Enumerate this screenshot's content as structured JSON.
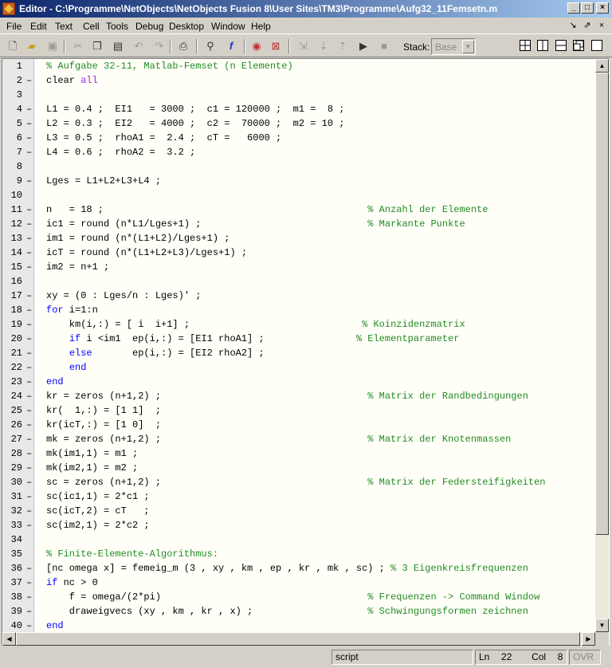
{
  "window": {
    "title": "Editor - C:\\Programme\\NetObjects\\NetObjects Fusion 8\\User Sites\\TM3\\Programme\\Aufg32_11Femsetn.m",
    "minimize": "_",
    "maximize": "□",
    "close": "×"
  },
  "menu": [
    "File",
    "Edit",
    "Text",
    "Cell",
    "Tools",
    "Debug",
    "Desktop",
    "Window",
    "Help"
  ],
  "mdi": {
    "undock": "↘",
    "restore": "⇗",
    "close": "×"
  },
  "toolbar": {
    "stack_label": "Stack:",
    "stack_value": "Base"
  },
  "code_lines": [
    {
      "n": "1",
      "d": "",
      "html": "<span class=\"cm\">% Aufgabe 32-11, Matlab-Femset (n Elemente)</span>"
    },
    {
      "n": "2",
      "d": "–",
      "html": "clear <span class=\"str\">all</span>"
    },
    {
      "n": "3",
      "d": "",
      "html": ""
    },
    {
      "n": "4",
      "d": "–",
      "html": "L1 = 0.4 ;  EI1   = 3000 ;  c1 = 120000 ;  m1 =  8 ;"
    },
    {
      "n": "5",
      "d": "–",
      "html": "L2 = 0.3 ;  EI2   = 4000 ;  c2 =  70000 ;  m2 = 10 ;"
    },
    {
      "n": "6",
      "d": "–",
      "html": "L3 = 0.5 ;  rhoA1 =  2.4 ;  cT =   6000 ;"
    },
    {
      "n": "7",
      "d": "–",
      "html": "L4 = 0.6 ;  rhoA2 =  3.2 ;"
    },
    {
      "n": "8",
      "d": "",
      "html": ""
    },
    {
      "n": "9",
      "d": "–",
      "html": "Lges = L1+L2+L3+L4 ;"
    },
    {
      "n": "10",
      "d": "",
      "html": ""
    },
    {
      "n": "11",
      "d": "–",
      "html": "n   = 18 ;                                              <span class=\"cm\">% Anzahl der Elemente</span>"
    },
    {
      "n": "12",
      "d": "–",
      "html": "ic1 = round (n*L1/Lges+1) ;                             <span class=\"cm\">% Markante Punkte</span>"
    },
    {
      "n": "13",
      "d": "–",
      "html": "im1 = round (n*(L1+L2)/Lges+1) ;"
    },
    {
      "n": "14",
      "d": "–",
      "html": "icT = round (n*(L1+L2+L3)/Lges+1) ;"
    },
    {
      "n": "15",
      "d": "–",
      "html": "im2 = n+1 ;"
    },
    {
      "n": "16",
      "d": "",
      "html": ""
    },
    {
      "n": "17",
      "d": "–",
      "html": "xy = (0 : Lges/n : Lges)' ;"
    },
    {
      "n": "18",
      "d": "–",
      "html": "<span class=\"kw\">for</span> i=1:n"
    },
    {
      "n": "19",
      "d": "–",
      "html": "    km(i,:) = [ i  i+1] ;                              <span class=\"cm\">% Koinzidenzmatrix</span>"
    },
    {
      "n": "20",
      "d": "–",
      "html": "    <span class=\"kw\">if</span> i &lt;im1  ep(i,:) = [EI1 rhoA1] ;                <span class=\"cm\">% Elementparameter</span>"
    },
    {
      "n": "21",
      "d": "–",
      "html": "    <span class=\"kw\">else</span>       ep(i,:) = [EI2 rhoA2] ;"
    },
    {
      "n": "22",
      "d": "–",
      "html": "    <span class=\"kw\">end</span>"
    },
    {
      "n": "23",
      "d": "–",
      "html": "<span class=\"kw\">end</span>"
    },
    {
      "n": "24",
      "d": "–",
      "html": "kr = zeros (n+1,2) ;                                    <span class=\"cm\">% Matrix der Randbedingungen</span>"
    },
    {
      "n": "25",
      "d": "–",
      "html": "kr(  1,:) = [1 1]  ;"
    },
    {
      "n": "26",
      "d": "–",
      "html": "kr(icT,:) = [1 0]  ;"
    },
    {
      "n": "27",
      "d": "–",
      "html": "mk = zeros (n+1,2) ;                                    <span class=\"cm\">% Matrix der Knotenmassen</span>"
    },
    {
      "n": "28",
      "d": "–",
      "html": "mk(im1,1) = m1 ;"
    },
    {
      "n": "29",
      "d": "–",
      "html": "mk(im2,1) = m2 ;"
    },
    {
      "n": "30",
      "d": "–",
      "html": "sc = zeros (n+1,2) ;                                    <span class=\"cm\">% Matrix der Federsteifigkeiten</span>"
    },
    {
      "n": "31",
      "d": "–",
      "html": "sc(ic1,1) = 2*c1 ;"
    },
    {
      "n": "32",
      "d": "–",
      "html": "sc(icT,2) = cT   ;"
    },
    {
      "n": "33",
      "d": "–",
      "html": "sc(im2,1) = 2*c2 ;"
    },
    {
      "n": "34",
      "d": "",
      "html": ""
    },
    {
      "n": "35",
      "d": "",
      "html": "<span class=\"cm\">% Finite-Elemente-Algorithmus:</span>"
    },
    {
      "n": "36",
      "d": "–",
      "html": "[nc omega x] = femeig_m (3 , xy , km , ep , kr , mk , sc) ; <span class=\"cm\">% 3 Eigenkreisfrequenzen</span>"
    },
    {
      "n": "37",
      "d": "–",
      "html": "<span class=\"kw\">if</span> nc &gt; 0"
    },
    {
      "n": "38",
      "d": "–",
      "html": "    f = omega/(2*pi)                                    <span class=\"cm\">% Frequenzen -&gt; Command Window</span>"
    },
    {
      "n": "39",
      "d": "–",
      "html": "    draweigvecs (xy , km , kr , x) ;                    <span class=\"cm\">% Schwingungsformen zeichnen</span>"
    },
    {
      "n": "40",
      "d": "–",
      "html": "<span class=\"kw\">end</span>"
    }
  ],
  "status": {
    "mode": "script",
    "ln_label": "Ln",
    "ln_value": "22",
    "col_label": "Col",
    "col_value": "8",
    "ovr": "OVR"
  }
}
